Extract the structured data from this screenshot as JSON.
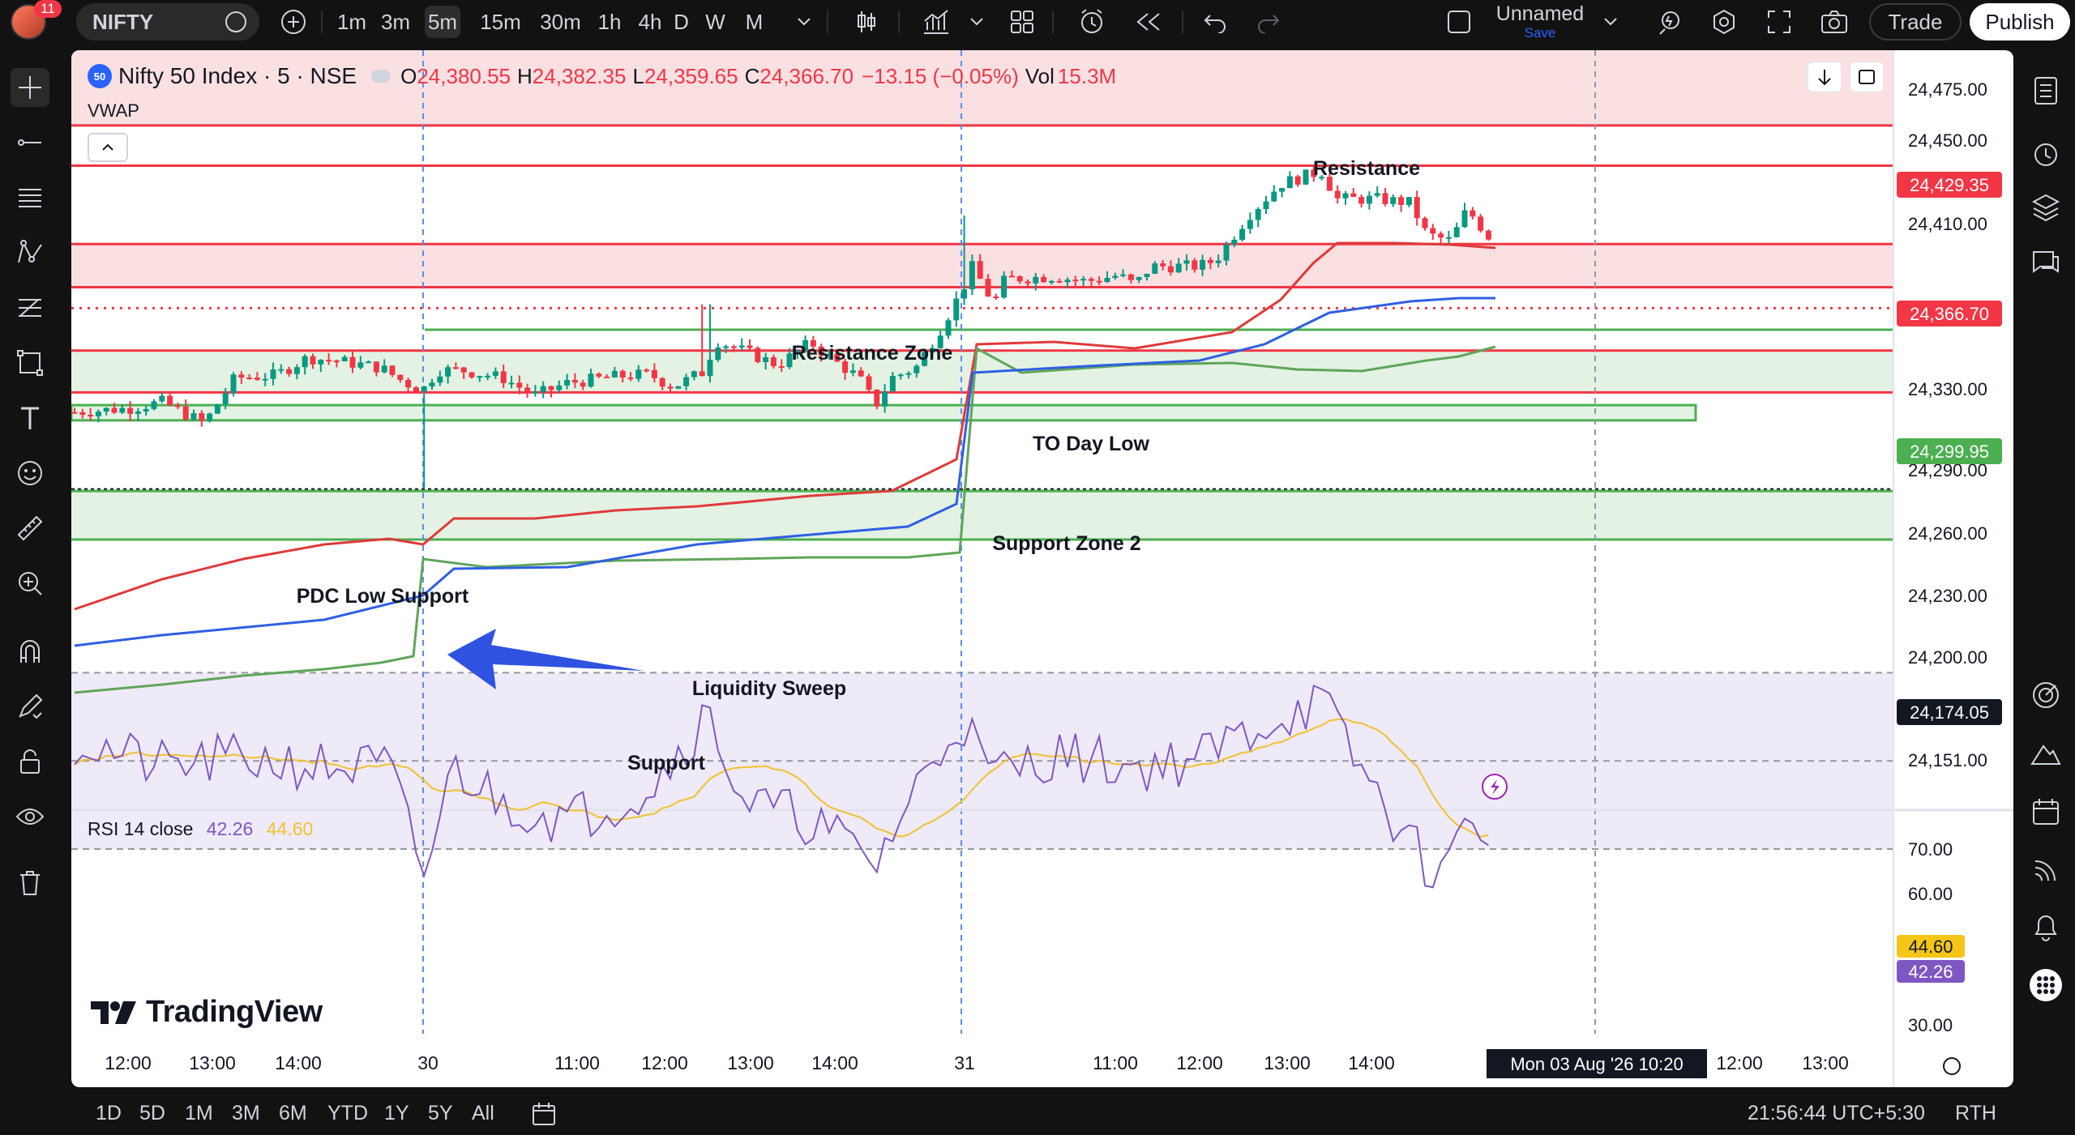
{
  "topbar": {
    "notifications": "11",
    "symbol": "NIFTY",
    "intervals": [
      "1m",
      "3m",
      "5m",
      "15m",
      "30m",
      "1h",
      "4h",
      "D",
      "W",
      "M"
    ],
    "active_interval": "5m",
    "layout_name": "Unnamed",
    "layout_save": "Save",
    "trade_label": "Trade",
    "publish_label": "Publish"
  },
  "legend": {
    "logo": "50",
    "name": "Nifty 50 Index · 5 · NSE",
    "o_key": "O",
    "o": "24,380.55",
    "h_key": "H",
    "h": "24,382.35",
    "l_key": "L",
    "l": "24,359.65",
    "c_key": "C",
    "c": "24,366.70",
    "change": "−13.15 (−0.05%)",
    "vol_key": "Vol",
    "vol": "15.3M",
    "vwap": "VWAP"
  },
  "rsi_legend": {
    "label": "RSI 14 close",
    "rsi": "42.26",
    "ma": "44.60"
  },
  "annotations": [
    "Resistance",
    "Resistance Zone",
    "TO Day Low",
    "Support Zone 2",
    "PDC Low Support",
    "Liquidity Sweep",
    "Support"
  ],
  "price_axis": [
    "24,475.00",
    "24,450.00",
    "24,410.00",
    "24,330.00",
    "24,290.00",
    "24,260.00",
    "24,230.00",
    "24,200.00",
    "24,151.00"
  ],
  "price_badges": [
    {
      "price": "24,429.35",
      "color": "#f23645"
    },
    {
      "price": "24,366.70",
      "color": "#f23645"
    },
    {
      "price": "24,299.95",
      "color": "#4caf50"
    },
    {
      "price": "24,174.05",
      "color": "#131722"
    }
  ],
  "rsi_axis": [
    "70.00",
    "60.00",
    "40.00",
    "30.00"
  ],
  "rsi_badges": [
    {
      "value": "44.60",
      "color": "#f5c518",
      "text": "#131722"
    },
    {
      "value": "42.26",
      "color": "#7e57c2",
      "text": "#ffffff"
    }
  ],
  "time_axis": [
    "12:00",
    "13:00",
    "14:00",
    "30",
    "11:00",
    "12:00",
    "13:00",
    "14:00",
    "31",
    "11:00",
    "12:00",
    "13:00",
    "14:00",
    "12:00",
    "13:00"
  ],
  "crosshair_time": "Mon 03 Aug '26   10:20",
  "branding": "TradingView",
  "bottombar": {
    "ranges": [
      "1D",
      "5D",
      "1M",
      "3M",
      "6M",
      "YTD",
      "1Y",
      "5Y",
      "All"
    ],
    "clock": "21:56:44 UTC+5:30",
    "session": "RTH"
  },
  "chart_data": {
    "type": "candlestick",
    "symbol": "Nifty 50 Index",
    "interval": "5",
    "exchange": "NSE",
    "last_price": 24366.7,
    "ylim": [
      24130,
      24490
    ],
    "levels": [
      {
        "name": "Resistance",
        "price": 24429.35,
        "color": "#f23645"
      },
      {
        "name": "Resistance Zone top",
        "price": 24367.5,
        "color": "#f23645"
      },
      {
        "name": "Resistance Zone bottom",
        "price": 24333.5,
        "color": "#f23645"
      },
      {
        "name": "TO Day Low",
        "price": 24299.95,
        "color": "#4caf50"
      },
      {
        "name": "Support Zone 2 top",
        "price": 24283.5,
        "color": "#f23645"
      },
      {
        "name": "Support Zone 2 bottom",
        "price": 24250.5,
        "color": "#f23645"
      },
      {
        "name": "PDC Low Support top",
        "price": 24240.5,
        "color": "#4caf50"
      },
      {
        "name": "PDC Low Support bottom",
        "price": 24228.5,
        "color": "#4caf50"
      },
      {
        "name": "Support top",
        "price": 24174.05,
        "color": "#4caf50"
      },
      {
        "name": "Support bottom",
        "price": 24134.5,
        "color": "#4caf50"
      }
    ],
    "rsi": {
      "length": 14,
      "source": "close",
      "last": 42.26,
      "ma_last": 44.6,
      "upper": 70,
      "middle": 50,
      "lower": 30
    }
  }
}
